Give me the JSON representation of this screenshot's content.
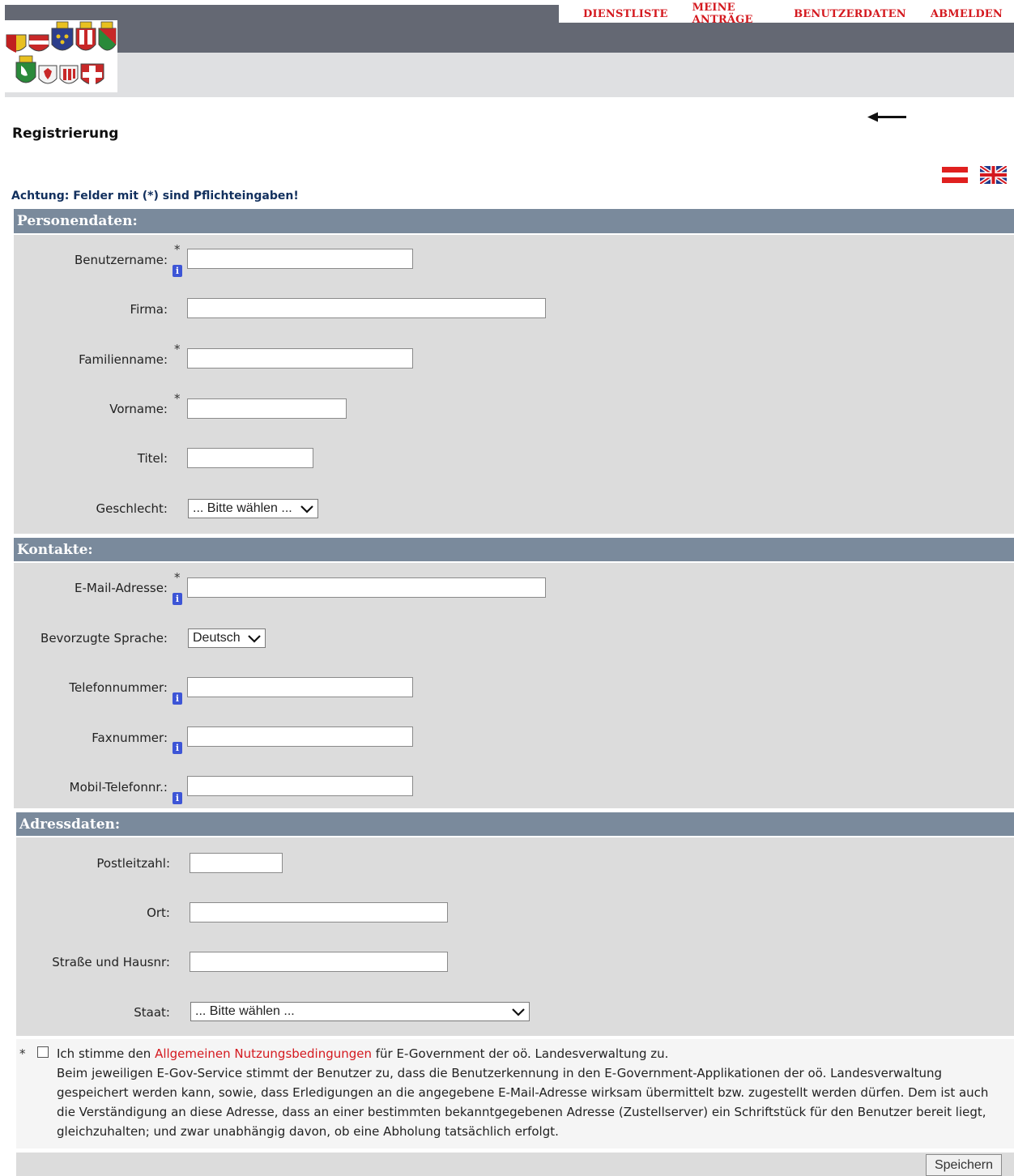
{
  "nav": {
    "items": [
      "DIENSTLISTE",
      "MEINE ANTRÄGE",
      "BENUTZERDATEN",
      "ABMELDEN"
    ]
  },
  "page_title": "Registrierung",
  "notice": "Achtung: Felder mit (*) sind Pflichteingaben!",
  "required_mark": "*",
  "info_glyph": "i",
  "sections": {
    "person": {
      "title": "Personendaten:",
      "benutzername": {
        "label": "Benutzername:",
        "value": ""
      },
      "firma": {
        "label": "Firma:",
        "value": ""
      },
      "familienname": {
        "label": "Familienname:",
        "value": ""
      },
      "vorname": {
        "label": "Vorname:",
        "value": ""
      },
      "titel": {
        "label": "Titel:",
        "value": ""
      },
      "geschlecht": {
        "label": "Geschlecht:",
        "selected": "... Bitte wählen ..."
      }
    },
    "contacts": {
      "title": "Kontakte:",
      "email": {
        "label": "E-Mail-Adresse:",
        "value": ""
      },
      "sprache": {
        "label": "Bevorzugte Sprache:",
        "selected": "Deutsch"
      },
      "telefon": {
        "label": "Telefonnummer:",
        "value": ""
      },
      "fax": {
        "label": "Faxnummer:",
        "value": ""
      },
      "mobil": {
        "label": "Mobil-Telefonnr.:",
        "value": ""
      }
    },
    "address": {
      "title": "Adressdaten:",
      "plz": {
        "label": "Postleitzahl:",
        "value": ""
      },
      "ort": {
        "label": "Ort:",
        "value": ""
      },
      "strasse": {
        "label": "Straße und Hausnr:",
        "value": ""
      },
      "staat": {
        "label": "Staat:",
        "selected": "... Bitte wählen ..."
      }
    }
  },
  "consent": {
    "prefix": "Ich stimme den ",
    "link": "Allgemeinen Nutzungsbedingungen",
    "suffix": " für E-Government der oö. Landesverwaltung zu.",
    "body": "Beim jeweiligen E-Gov-Service stimmt der Benutzer zu, dass die Benutzerkennung in den E-Government-Applikationen der oö. Landesverwaltung gespeichert werden kann, sowie, dass Erledigungen an die angegebene E-Mail-Adresse wirksam übermittelt bzw. zugestellt werden dürfen. Dem ist auch die Verständigung an diese Adresse, dass an einer bestimmten bekanntgegebenen Adresse (Zustellserver) ein Schriftstück für den Benutzer bereit liegt, gleichzuhalten; und zwar unabhängig davon, ob eine Abholung tatsächlich erfolgt.",
    "checked": false
  },
  "save_label": "Speichern",
  "colors": {
    "nav_text": "#d4191f",
    "top_bar": "#646873",
    "section_head": "#7a8a9c",
    "section_body": "#dcdcdc",
    "notice_text": "#12305e",
    "info_icon": "#3d55d6"
  },
  "icons": {
    "logo": "coats-of-arms-logo",
    "back": "back-arrow-icon",
    "language_de": "austria-flag-icon",
    "language_en": "uk-flag-icon",
    "info": "info-icon",
    "dropdown": "chevron-down-icon"
  }
}
